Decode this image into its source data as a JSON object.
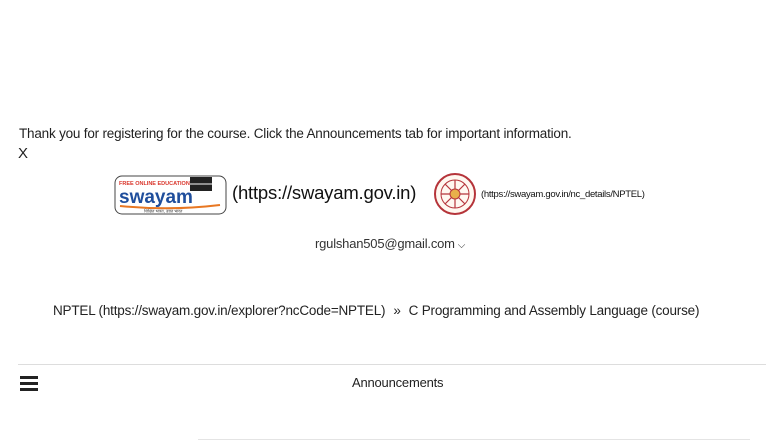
{
  "notice": {
    "message": "Thank you for registering for the course. Click the Announcements tab for important information.",
    "close_label": "X"
  },
  "branding": {
    "swayam_logo": {
      "tagline": "FREE ONLINE EDUCATION",
      "wordmark": "swayam",
      "subtitle": "शिक्षित भारत, उन्नत भारत"
    },
    "swayam_link": "(https://swayam.gov.in)",
    "nptel_link": "(https://swayam.gov.in/nc_details/NPTEL)"
  },
  "user": {
    "email": "rgulshan505@gmail.com",
    "dropdown_icon": "chevron-down-icon"
  },
  "breadcrumb": {
    "items": [
      "NPTEL (https://swayam.gov.in/explorer?ncCode=NPTEL)",
      "C Programming and Assembly Language (course)"
    ],
    "separator": "»"
  },
  "nav": {
    "menu_icon": "hamburger-icon",
    "title": "Announcements"
  },
  "colors": {
    "swayam_blue": "#1f4e9c",
    "swayam_orange": "#e87722",
    "nptel_red": "#b5343a"
  }
}
